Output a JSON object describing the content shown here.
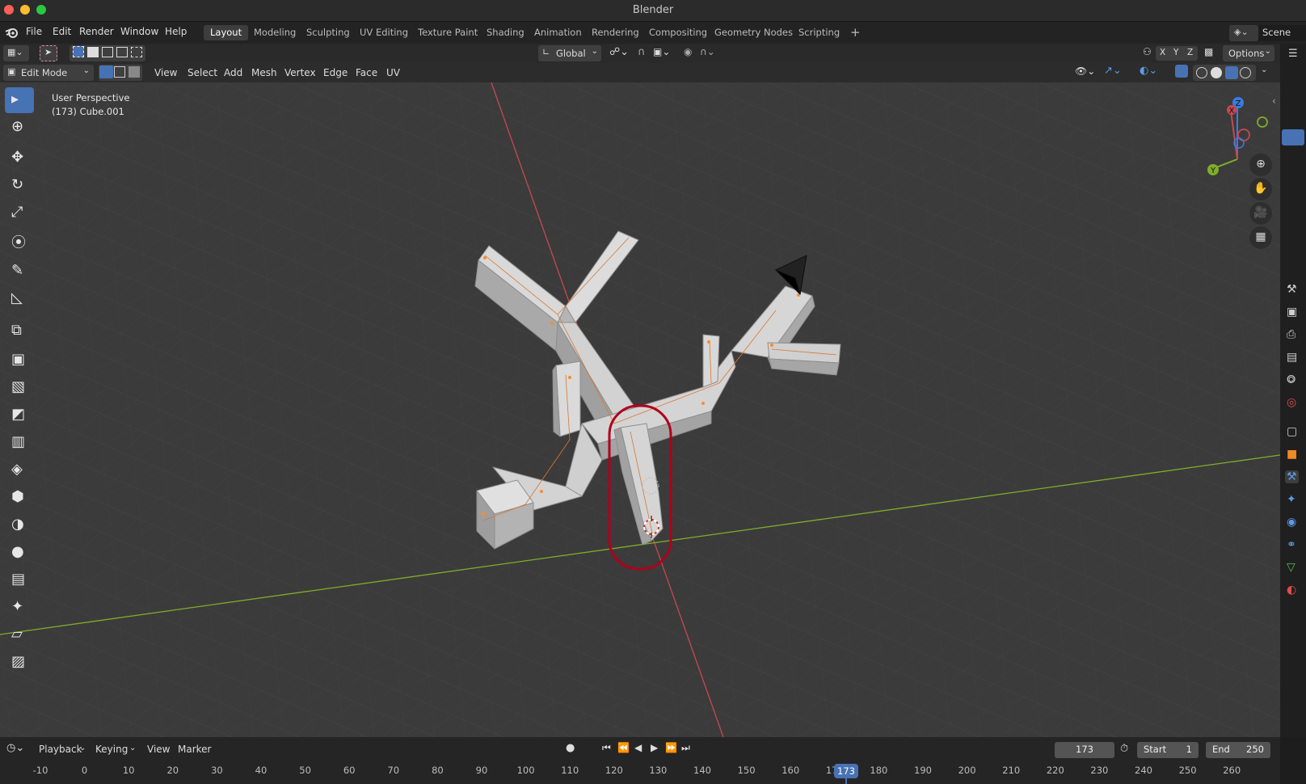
{
  "window": {
    "title": "Blender"
  },
  "menu": [
    "File",
    "Edit",
    "Render",
    "Window",
    "Help"
  ],
  "workspaces": [
    "Layout",
    "Modeling",
    "Sculpting",
    "UV Editing",
    "Texture Paint",
    "Shading",
    "Animation",
    "Rendering",
    "Compositing",
    "Geometry Nodes",
    "Scripting"
  ],
  "active_workspace": "Layout",
  "scene": {
    "name": "Scene"
  },
  "tool_header": {
    "orientation": "Global",
    "options_label": "Options",
    "axes": [
      "X",
      "Y",
      "Z"
    ]
  },
  "view_header": {
    "mode": "Edit Mode",
    "menus": [
      "View",
      "Select",
      "Add",
      "Mesh",
      "Vertex",
      "Edge",
      "Face",
      "UV"
    ]
  },
  "viewport": {
    "perspective": "User Perspective",
    "object": "(173) Cube.001",
    "gizmo_axes": [
      "Z",
      "Y",
      "X"
    ]
  },
  "toolbar": [
    "select-box-icon",
    "cursor-icon",
    "move-icon",
    "rotate-icon",
    "scale-icon",
    "transform-icon",
    "annotate-icon",
    "measure-icon",
    "add-cube-icon",
    "extrude-icon",
    "inset-icon",
    "bevel-icon",
    "loop-cut-icon",
    "knife-icon",
    "poly-build-icon",
    "spin-icon",
    "smooth-icon",
    "edge-slide-icon",
    "shrink-fatten-icon",
    "shear-icon",
    "rip-icon"
  ],
  "timeline": {
    "menus": [
      "Playback",
      "Keying",
      "View",
      "Marker"
    ],
    "current_frame": "173",
    "start_label": "Start",
    "start": "1",
    "end_label": "End",
    "end": "250",
    "ticks": [
      "-10",
      "0",
      "10",
      "20",
      "30",
      "40",
      "50",
      "60",
      "70",
      "80",
      "90",
      "100",
      "110",
      "120",
      "130",
      "140",
      "150",
      "160",
      "170",
      "180",
      "190",
      "200",
      "210",
      "220",
      "230",
      "240",
      "250",
      "260"
    ]
  },
  "properties_tabs": [
    "tool-icon",
    "render-icon",
    "output-icon",
    "view-layer-icon",
    "scene-icon",
    "world-icon",
    "collection-icon",
    "object-icon",
    "modifier-icon",
    "particles-icon",
    "physics-icon",
    "constraints-icon",
    "data-icon",
    "material-icon"
  ],
  "colors": {
    "accent": "#4772b3",
    "x_axis": "#c8484f",
    "y_axis": "#7fae2a",
    "z_axis": "#3a7be0",
    "highlight": "#b0001b"
  }
}
